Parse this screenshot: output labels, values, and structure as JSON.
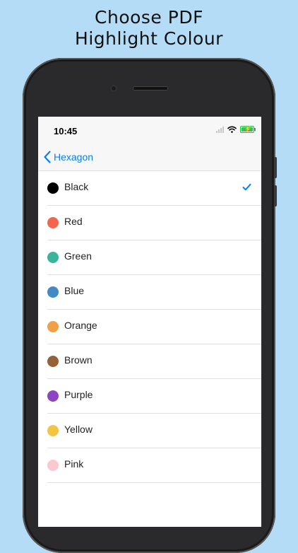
{
  "headline": {
    "line1": "Choose PDF",
    "line2": "Highlight Colour"
  },
  "status_bar": {
    "time": "10:45"
  },
  "nav": {
    "back_label": "Hexagon"
  },
  "colours": [
    {
      "label": "Black",
      "color": "#000000",
      "selected": true
    },
    {
      "label": "Red",
      "color": "#f26650",
      "selected": false
    },
    {
      "label": "Green",
      "color": "#3bb59a",
      "selected": false
    },
    {
      "label": "Blue",
      "color": "#4389c3",
      "selected": false
    },
    {
      "label": "Orange",
      "color": "#f0a046",
      "selected": false
    },
    {
      "label": "Brown",
      "color": "#946236",
      "selected": false
    },
    {
      "label": "Purple",
      "color": "#8e44c0",
      "selected": false
    },
    {
      "label": "Yellow",
      "color": "#f4c542",
      "selected": false
    },
    {
      "label": "Pink",
      "color": "#f9c8d0",
      "selected": false
    }
  ],
  "accent_color": "#0a7ff0",
  "background_color": "#b5dcf7",
  "icons": [
    "wifi-icon",
    "battery-icon",
    "back-chevron-icon",
    "checkmark-icon"
  ]
}
